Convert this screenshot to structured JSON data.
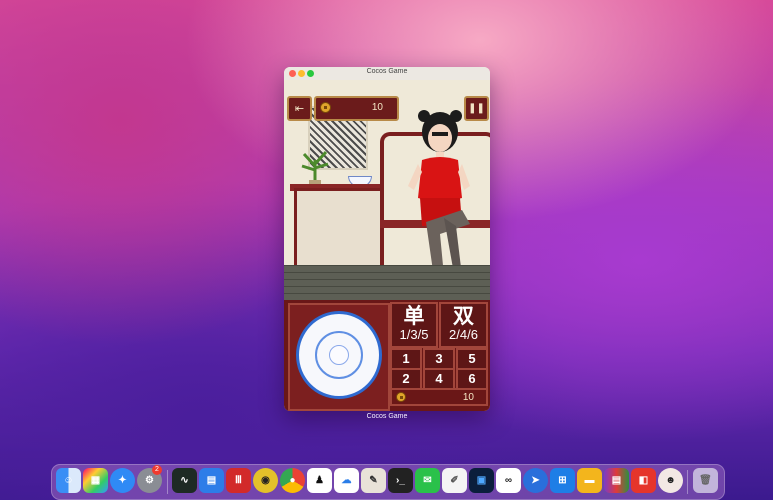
{
  "window": {
    "title": "Cocos Game",
    "caption": "Cocos Game"
  },
  "hud": {
    "exit_icon": "exit-door-icon",
    "coins": "10",
    "pause_icon": "pause-icon"
  },
  "bets": {
    "odd": {
      "label": "单",
      "numbers": "1/3/5"
    },
    "even": {
      "label": "双",
      "numbers": "2/4/6"
    },
    "numbers": [
      "1",
      "3",
      "5",
      "2",
      "4",
      "6"
    ]
  },
  "footer": {
    "coins": "10"
  },
  "dock": {
    "badge_count": "2",
    "apps": [
      "finder",
      "launchpad",
      "safari",
      "system-preferences",
      "activity-monitor",
      "numbers",
      "app-red-bars",
      "ue-app",
      "chrome",
      "qq",
      "baidu-netdisk",
      "app-editor",
      "terminal",
      "wechat",
      "text-editor",
      "photoshop",
      "app-link",
      "app-blue",
      "windows-app",
      "folder",
      "winrar",
      "pdf-app",
      "avatar-app",
      "trash"
    ]
  }
}
